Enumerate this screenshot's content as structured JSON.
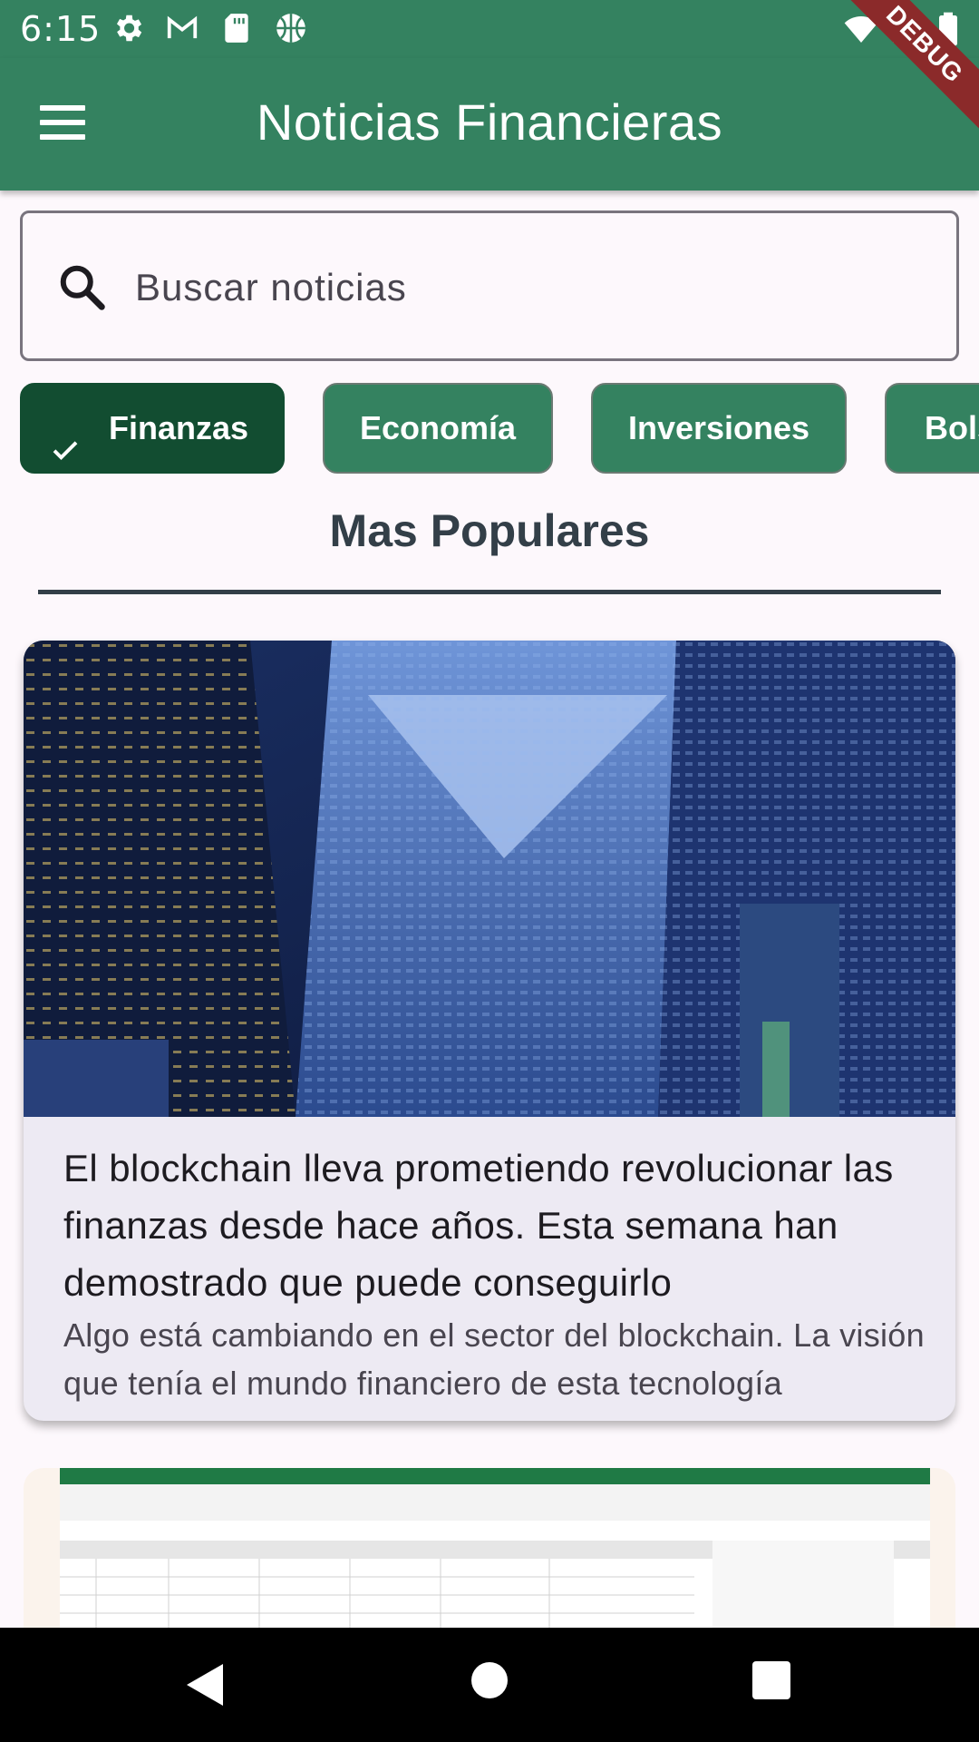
{
  "status_bar": {
    "time": "6:15",
    "icons_left": [
      "settings-icon",
      "gmail-icon",
      "sd-card-icon",
      "basketball-icon"
    ],
    "icons_right": [
      "wifi-icon",
      "signal-icon",
      "battery-icon"
    ]
  },
  "app_bar": {
    "title": "Noticias Financieras",
    "menu_icon": "menu-icon",
    "debug_banner": "DEBUG"
  },
  "search": {
    "placeholder": "Buscar noticias",
    "value": ""
  },
  "categories": [
    {
      "label": "Finanzas",
      "selected": true
    },
    {
      "label": "Economía",
      "selected": false
    },
    {
      "label": "Inversiones",
      "selected": false
    },
    {
      "label": "Bolsa",
      "selected": false
    }
  ],
  "section": {
    "title": "Mas Populares"
  },
  "articles": [
    {
      "title": "El blockchain lleva prometiendo revolucionar las finanzas desde hace años. Esta semana han demostrado que puede conseguirlo",
      "summary": "Algo está cambiando en el sector del blockchain. La visión que tenía el mundo financiero de esta tecnología"
    }
  ],
  "colors": {
    "primary": "#348260",
    "primary_dark": "#124d31",
    "section_text": "#333f48",
    "card_bg": "#edeaf3"
  },
  "nav_bar": {
    "icons": [
      "back-icon",
      "home-icon",
      "recents-icon"
    ]
  }
}
